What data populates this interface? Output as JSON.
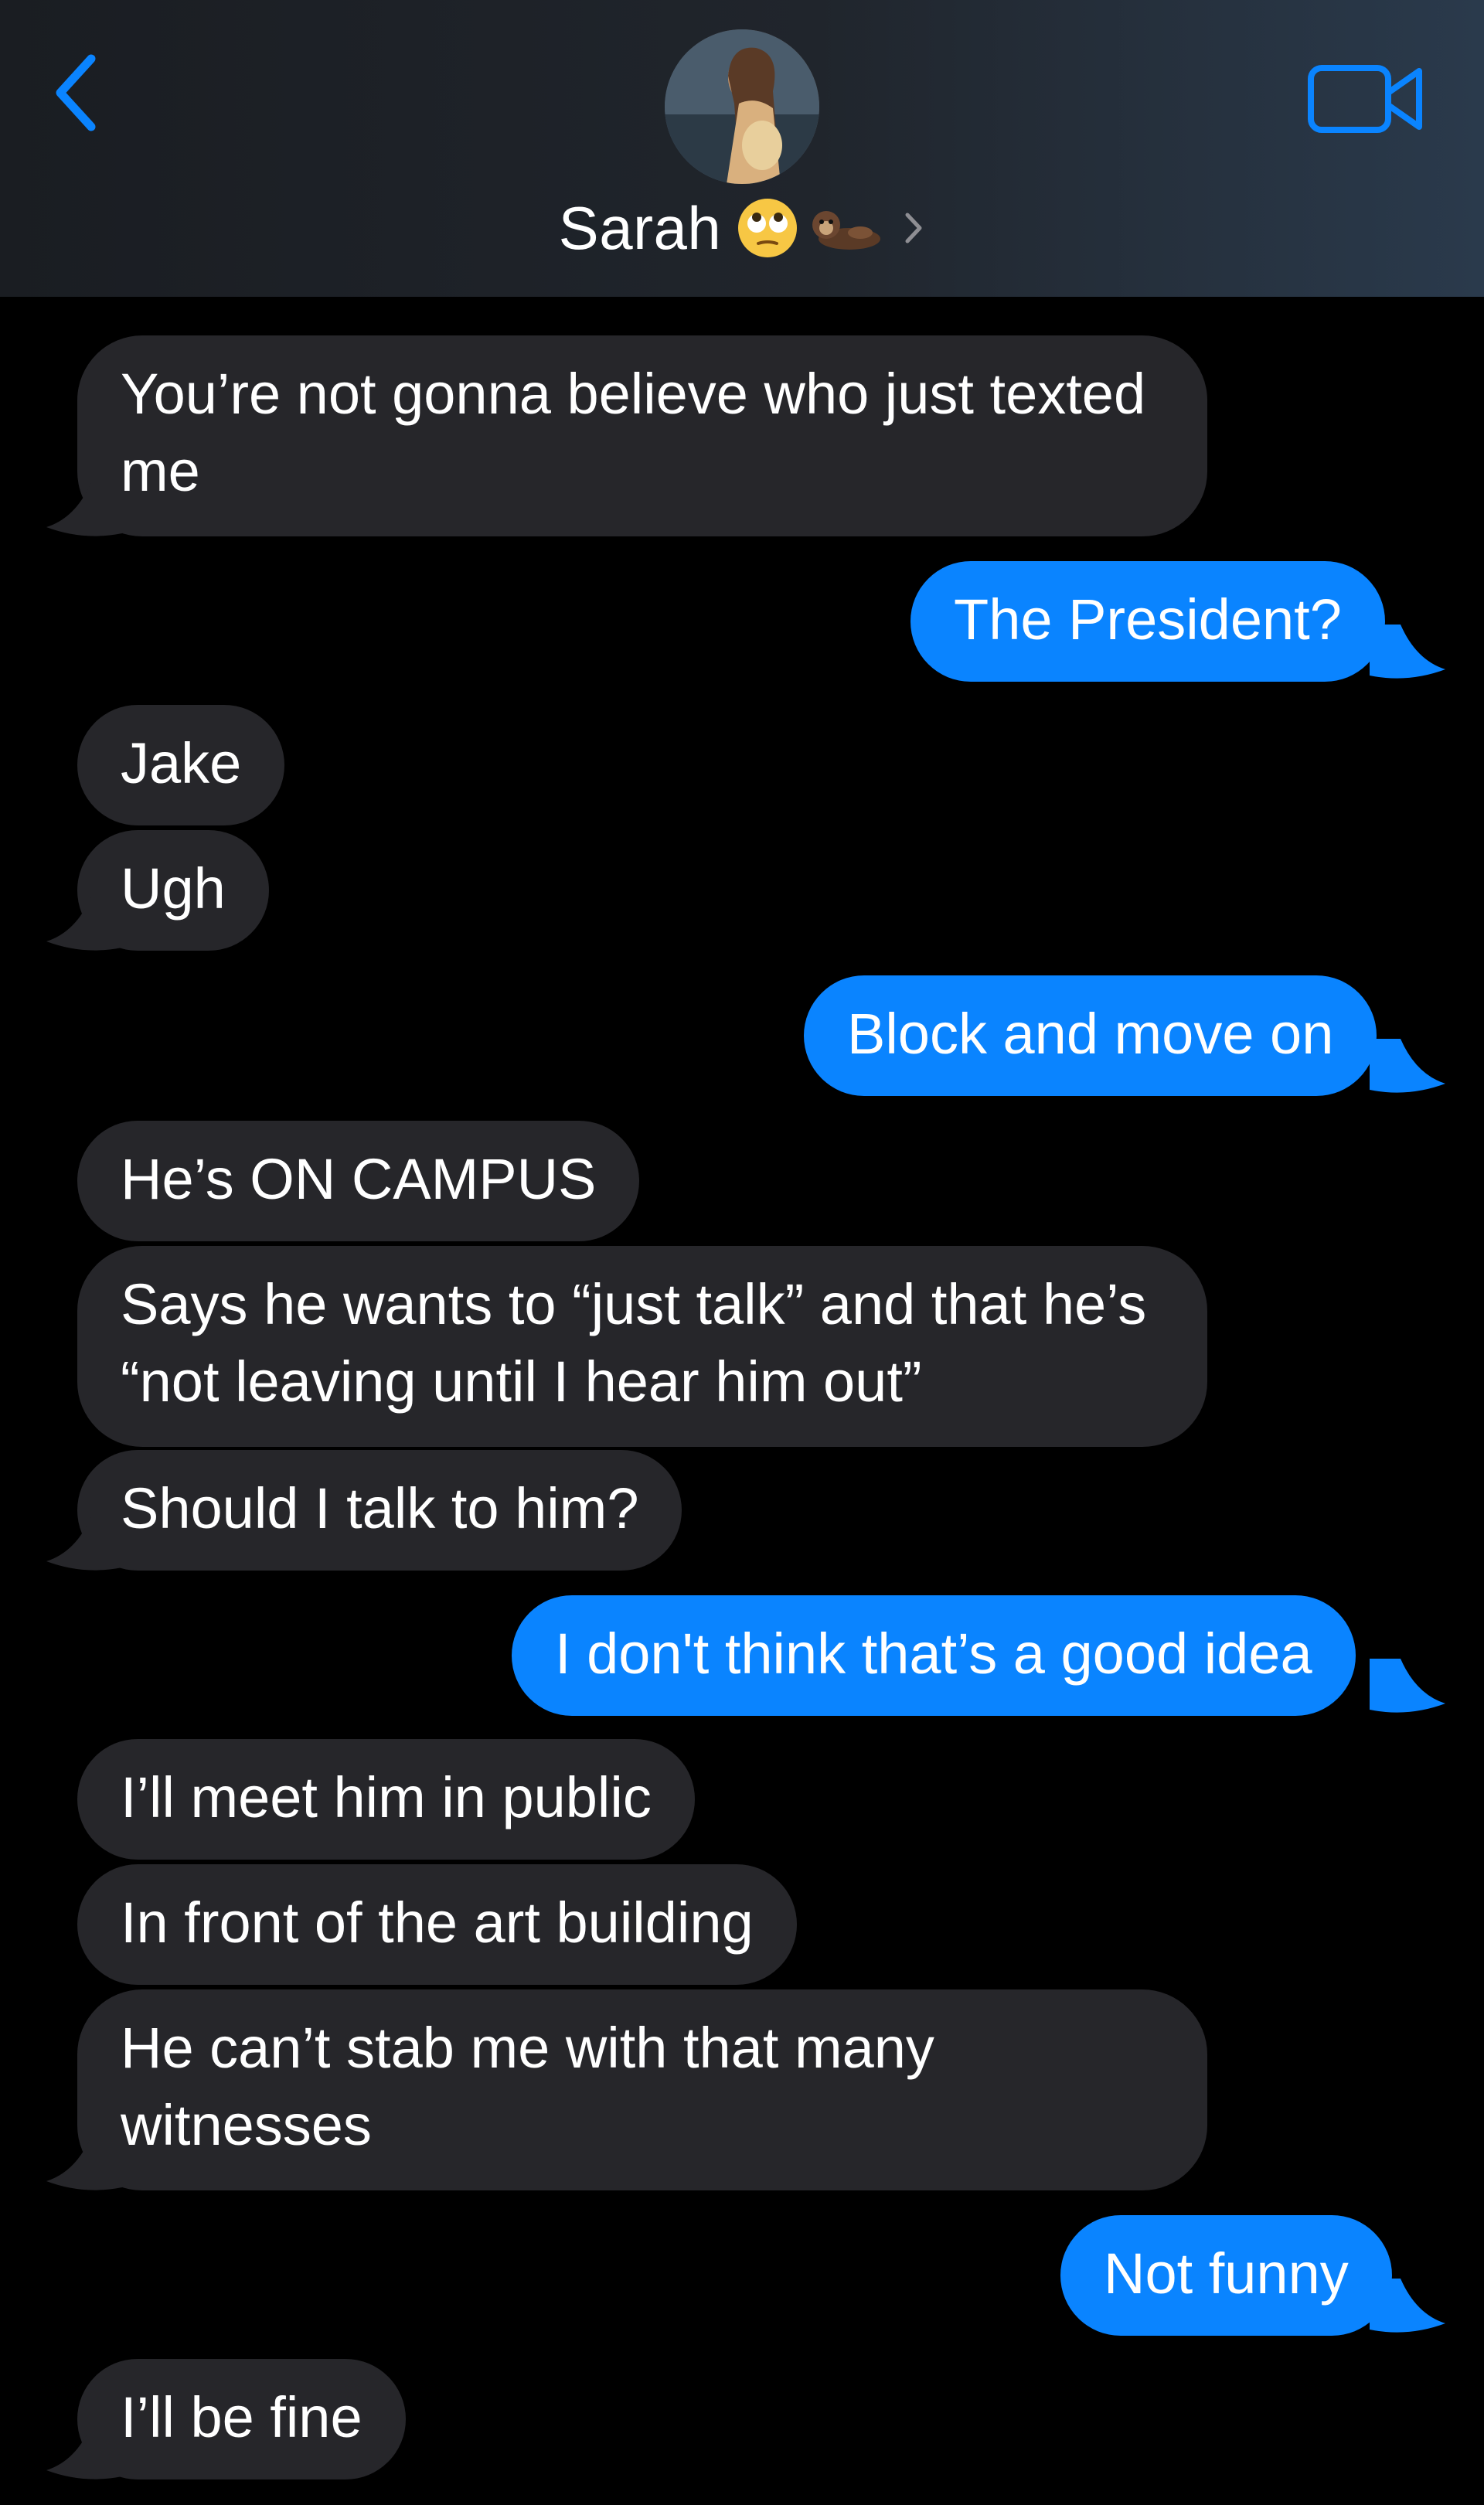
{
  "header": {
    "contact_name": "Sarah",
    "avatar_icon": "contact-photo",
    "emoji_icons": [
      "face-with-rolling-eyes-emoji",
      "otter-emoji"
    ],
    "back_icon": "chevron-left-icon",
    "video_icon": "video-camera-icon",
    "accent_color": "#0a84ff"
  },
  "messages": [
    {
      "from": "them",
      "text": "You’re not gonna believe who just texted me"
    },
    {
      "from": "me",
      "text": "The President?"
    },
    {
      "from": "them",
      "text": "Jake"
    },
    {
      "from": "them",
      "text": "Ugh"
    },
    {
      "from": "me",
      "text": "Block and move on"
    },
    {
      "from": "them",
      "text": "He’s ON CAMPUS"
    },
    {
      "from": "them",
      "text": "Says he wants to “just talk” and that he’s “not leaving until I hear him out”"
    },
    {
      "from": "them",
      "text": "Should I talk to him?"
    },
    {
      "from": "me",
      "text": "I don't think that’s a good idea"
    },
    {
      "from": "them",
      "text": "I’ll meet him in public"
    },
    {
      "from": "them",
      "text": "In front of the art building"
    },
    {
      "from": "them",
      "text": "He can’t stab me with that many witnesses"
    },
    {
      "from": "me",
      "text": "Not funny"
    },
    {
      "from": "them",
      "text": "I’ll be fine"
    }
  ]
}
